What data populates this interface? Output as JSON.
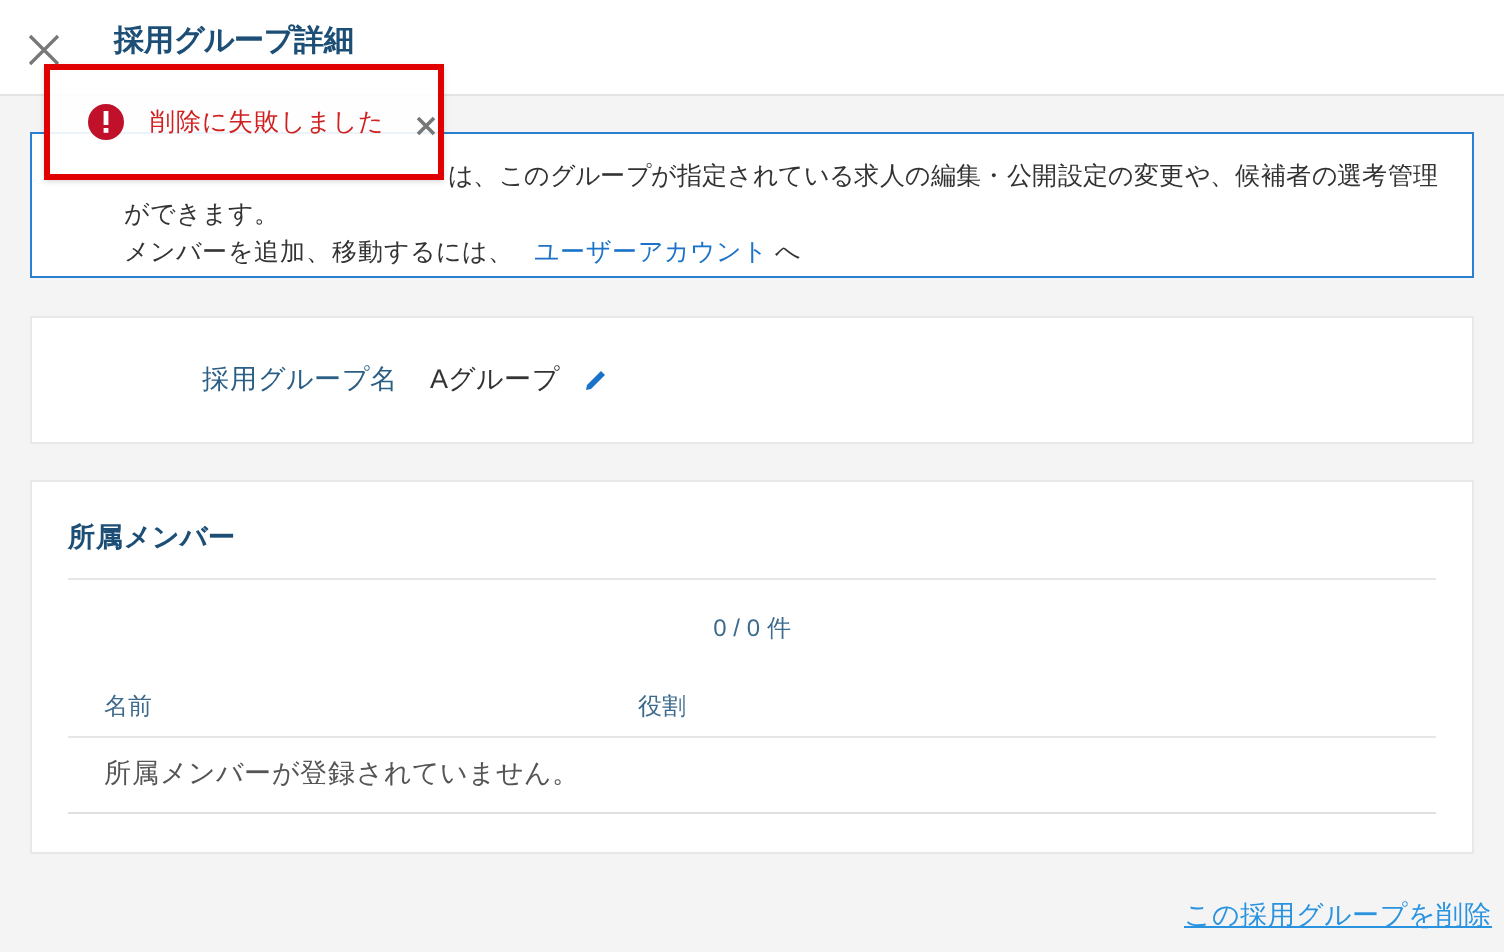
{
  "header": {
    "title": "採用グループ詳細"
  },
  "toast": {
    "message": "削除に失敗しました"
  },
  "info": {
    "line_1": "は、このグループが指定されている求人の編集・公開設定の変更や、候補者の選考管理",
    "line_2": "ができます。",
    "line_3_before": "メンバーを追加、移動するには、",
    "line_3_link": "ユーザーアカウント",
    "line_3_after": " へ"
  },
  "group_name": {
    "label": "採用グループ名",
    "value": "Aグループ"
  },
  "members": {
    "title": "所属メンバー",
    "count": "0 / 0 件",
    "columns": [
      "名前",
      "役割"
    ],
    "empty_message": "所属メンバーが登録されていません。"
  },
  "delete_link": "この採用グループを削除"
}
